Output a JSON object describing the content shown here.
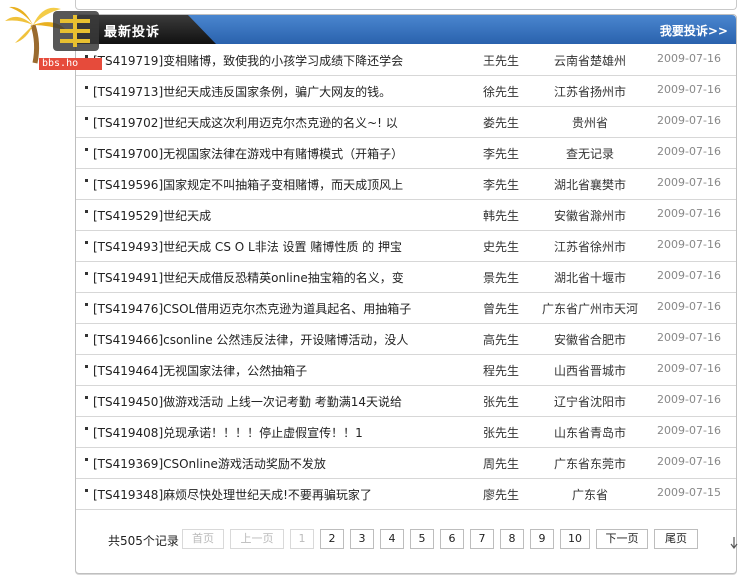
{
  "header": {
    "tab_title": "最新投诉",
    "complain_link": "我要投诉>>"
  },
  "logo": {
    "url_text": "bbs.ho"
  },
  "complaints": [
    {
      "title": "[TS419719]变相赌博，致使我的小孩学习成绩下降还学会",
      "name": "王先生",
      "location": "云南省楚雄州",
      "date": "2009-07-16"
    },
    {
      "title": "[TS419713]世纪天成违反国家条例，骗广大网友的钱。",
      "name": "徐先生",
      "location": "江苏省扬州市",
      "date": "2009-07-16"
    },
    {
      "title": "[TS419702]世纪天成这次利用迈克尔杰克逊的名义~! 以",
      "name": "娄先生",
      "location": "贵州省",
      "date": "2009-07-16"
    },
    {
      "title": "[TS419700]无视国家法律在游戏中有赌博模式（开箱子）",
      "name": "李先生",
      "location": "查无记录",
      "date": "2009-07-16"
    },
    {
      "title": "[TS419596]国家规定不叫抽箱子变相赌博，而天成顶风上",
      "name": "李先生",
      "location": "湖北省襄樊市",
      "date": "2009-07-16"
    },
    {
      "title": "[TS419529]世纪天成",
      "name": "韩先生",
      "location": "安徽省滁州市",
      "date": "2009-07-16"
    },
    {
      "title": "[TS419493]世纪天成 CS O L非法 设置 赌博性质 的 押宝",
      "name": "史先生",
      "location": "江苏省徐州市",
      "date": "2009-07-16"
    },
    {
      "title": "[TS419491]世纪天成借反恐精英online抽宝箱的名义，变",
      "name": "景先生",
      "location": "湖北省十堰市",
      "date": "2009-07-16"
    },
    {
      "title": "[TS419476]CSOL借用迈克尔杰克逊为道具起名、用抽箱子",
      "name": "曾先生",
      "location": "广东省广州市天河",
      "date": "2009-07-16"
    },
    {
      "title": "[TS419466]csonline 公然违反法律，开设赌博活动，没人",
      "name": "高先生",
      "location": "安徽省合肥市",
      "date": "2009-07-16"
    },
    {
      "title": "[TS419464]无视国家法律，公然抽箱子",
      "name": "程先生",
      "location": "山西省晋城市",
      "date": "2009-07-16"
    },
    {
      "title": "[TS419450]做游戏活动 上线一次记考勤 考勤满14天说给",
      "name": "张先生",
      "location": "辽宁省沈阳市",
      "date": "2009-07-16"
    },
    {
      "title": "[TS419408]兑现承诺！！！！停止虚假宣传！！1",
      "name": "张先生",
      "location": "山东省青岛市",
      "date": "2009-07-16"
    },
    {
      "title": "[TS419369]CSOnline游戏活动奖励不发放",
      "name": "周先生",
      "location": "广东省东莞市",
      "date": "2009-07-16"
    },
    {
      "title": "[TS419348]麻烦尽快处理世纪天成!不要再骗玩家了",
      "name": "廖先生",
      "location": "广东省",
      "date": "2009-07-15"
    }
  ],
  "pager": {
    "total": "共505个记录",
    "first": "首页",
    "prev": "上一页",
    "pages": [
      "1",
      "2",
      "3",
      "4",
      "5",
      "6",
      "7",
      "8",
      "9",
      "10"
    ],
    "next": "下一页",
    "last": "尾页"
  },
  "colors": {
    "header_blue": "#2a62ad",
    "tab_dark": "#111111",
    "date_gray": "#888888"
  }
}
